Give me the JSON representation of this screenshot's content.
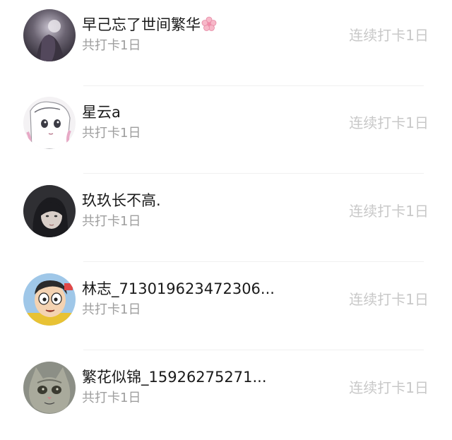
{
  "rows": [
    {
      "name": "早己忘了世间繁华",
      "name_emoji": "cherry-blossom",
      "checkins": "共打卡1日",
      "streak": "连续打卡1日"
    },
    {
      "name": "星云a",
      "checkins": "共打卡1日",
      "streak": "连续打卡1日"
    },
    {
      "name": "玖玖长不高.",
      "checkins": "共打卡1日",
      "streak": "连续打卡1日"
    },
    {
      "name": "林志_713019623472306...",
      "checkins": "共打卡1日",
      "streak": "连续打卡1日"
    },
    {
      "name": "繁花似锦_15926275271...",
      "checkins": "共打卡1日",
      "streak": "连续打卡1日"
    }
  ]
}
